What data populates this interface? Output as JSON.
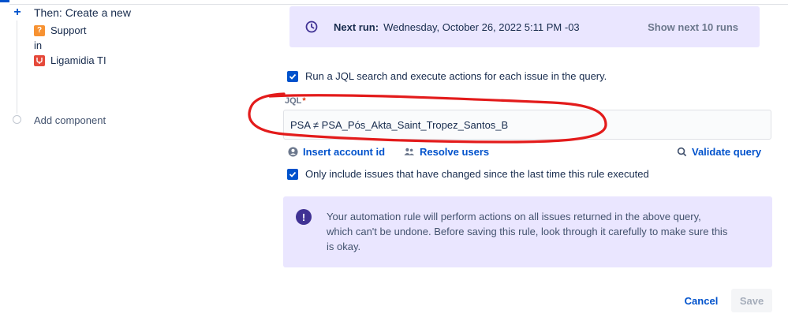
{
  "left_panel": {
    "then_title": "Then: Create a new",
    "project_issue_type": "Support",
    "in_label": "in",
    "project_name": "Ligamidia TI",
    "add_component": "Add component"
  },
  "next_run": {
    "label": "Next run:",
    "value": "Wednesday, October 26, 2022 5:11 PM -03",
    "show_next": "Show next 10 runs"
  },
  "jql_section": {
    "run_search_label": "Run a JQL search and execute actions for each issue in the query.",
    "run_search_checked": true,
    "field_label": "JQL",
    "required_marker": "*",
    "field_value": "PSA ≠ PSA_Pós_Akta_Saint_Tropez_Santos_B",
    "insert_account_id": "Insert account id",
    "resolve_users": "Resolve users",
    "validate_query": "Validate query",
    "only_include_label": "Only include issues that have changed since the last time this rule executed",
    "only_include_checked": true
  },
  "warning": {
    "icon": "exclamation-icon",
    "line1": "Your automation rule will perform actions on all issues returned in the above query,",
    "line2": "which can't be undone. Before saving this rule, look through it carefully to make sure this",
    "line3": "is okay."
  },
  "footer": {
    "cancel_label": "Cancel",
    "save_label": "Save"
  },
  "colors": {
    "accent": "#0052cc",
    "panel_bg": "#eae6ff",
    "annotation": "#e31b1b"
  }
}
